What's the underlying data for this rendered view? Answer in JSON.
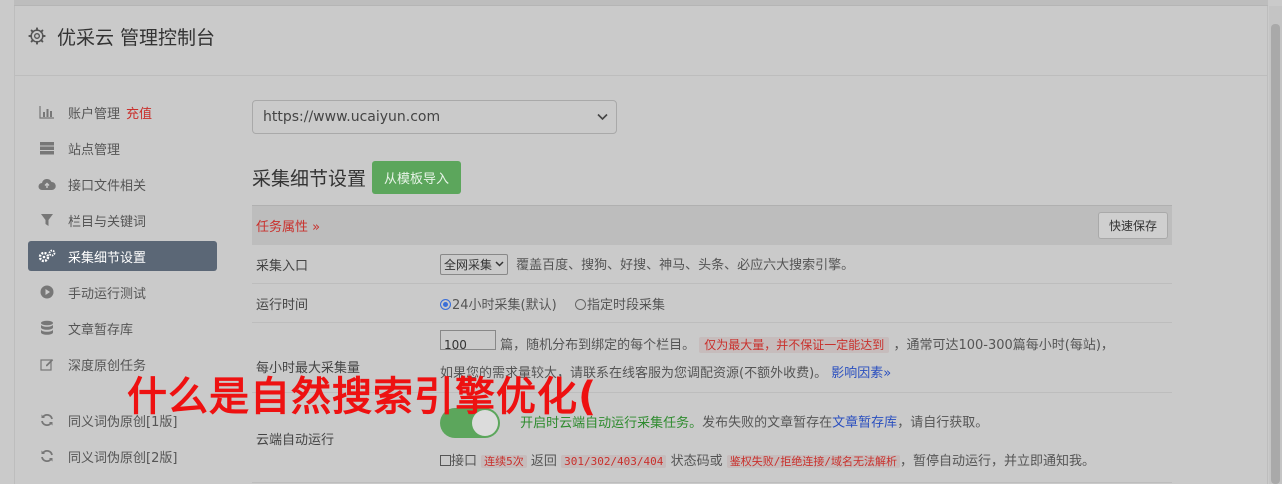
{
  "header": {
    "title": "优采云 管理控制台",
    "icon": "gear-icon"
  },
  "sidebar": {
    "items": [
      {
        "label": "账户管理",
        "badge": "充值",
        "icon": "bar-chart-icon",
        "active": false
      },
      {
        "label": "站点管理",
        "icon": "server-icon",
        "active": false
      },
      {
        "label": "接口文件相关",
        "icon": "cloud-upload-icon",
        "active": false
      },
      {
        "label": "栏目与关键词",
        "icon": "filter-icon",
        "active": false
      },
      {
        "label": "采集细节设置",
        "icon": "gears-icon",
        "active": true
      },
      {
        "label": "手动运行测试",
        "icon": "play-circle-icon",
        "active": false
      },
      {
        "label": "文章暂存库",
        "icon": "database-icon",
        "active": false
      },
      {
        "label": "深度原创任务",
        "icon": "edit-icon",
        "active": false
      },
      {
        "label": "同义词伪原创[1版]",
        "icon": "refresh-icon",
        "active": false
      },
      {
        "label": "同义词伪原创[2版]",
        "icon": "refresh-icon",
        "active": false
      }
    ]
  },
  "main": {
    "site_select": "https://www.ucaiyun.com",
    "section_title": "采集细节设置",
    "import_button": "从模板导入",
    "task_props_label": "任务属性 »",
    "quick_save": "快速保存",
    "rows": {
      "entry": {
        "label": "采集入口",
        "select_value": "全网采集",
        "desc": "覆盖百度、搜狗、好搜、神马、头条、必应六大搜索引擎。"
      },
      "runtime": {
        "label": "运行时间",
        "opt1": "24小时采集(默认)",
        "opt2": "指定时段采集"
      },
      "max_per_hour": {
        "label": "每小时最大采集量",
        "value": "100",
        "unit_text": "篇，随机分布到绑定的每个栏目。",
        "warn": "仅为最大量，并不保证一定能达到",
        "tail": "，通常可达100-300篇每小时(每站)，",
        "line2": "如果您的需求量较大，请联系在线客服为您调配资源(不额外收费)。",
        "link": "影响因素»"
      },
      "cloud": {
        "label": "云端自动运行",
        "toggle_on": true,
        "green": "开启时云端自动运行采集任务。",
        "desc_a": "发布失败的文章暂存在",
        "link": "文章暂存库",
        "desc_b": "，请自行获取。",
        "cb_label": "接口",
        "warn1": "连续5次",
        "mid1": "返回",
        "codes": "301/302/403/404",
        "mid2": "状态码或",
        "warn2": "鉴权失败/拒绝连接/域名无法解析",
        "tail": "，暂停自动运行，并立即通知我。"
      }
    }
  },
  "overlay_text": "什么是自然搜索引擎优化("
}
